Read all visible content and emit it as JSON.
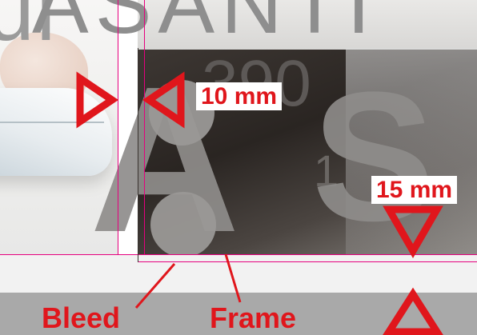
{
  "background_text": {
    "left_partial": "ul",
    "top_word": "ASANTI",
    "number": "390",
    "one": "1",
    "big_letter_a": "A",
    "big_letter_s": "S"
  },
  "annotations": {
    "horizontal_measure": "10 mm",
    "vertical_measure": "15 mm",
    "bleed_label": "Bleed",
    "frame_label": "Frame"
  },
  "colors": {
    "annotation_red": "#e0161c",
    "guide_magenta": "#e6007e",
    "band_grey": "#a9a9a9"
  },
  "icons": [
    "arrow-right-outline-icon",
    "arrow-left-outline-icon",
    "arrow-down-outline-icon",
    "arrow-up-outline-icon"
  ]
}
